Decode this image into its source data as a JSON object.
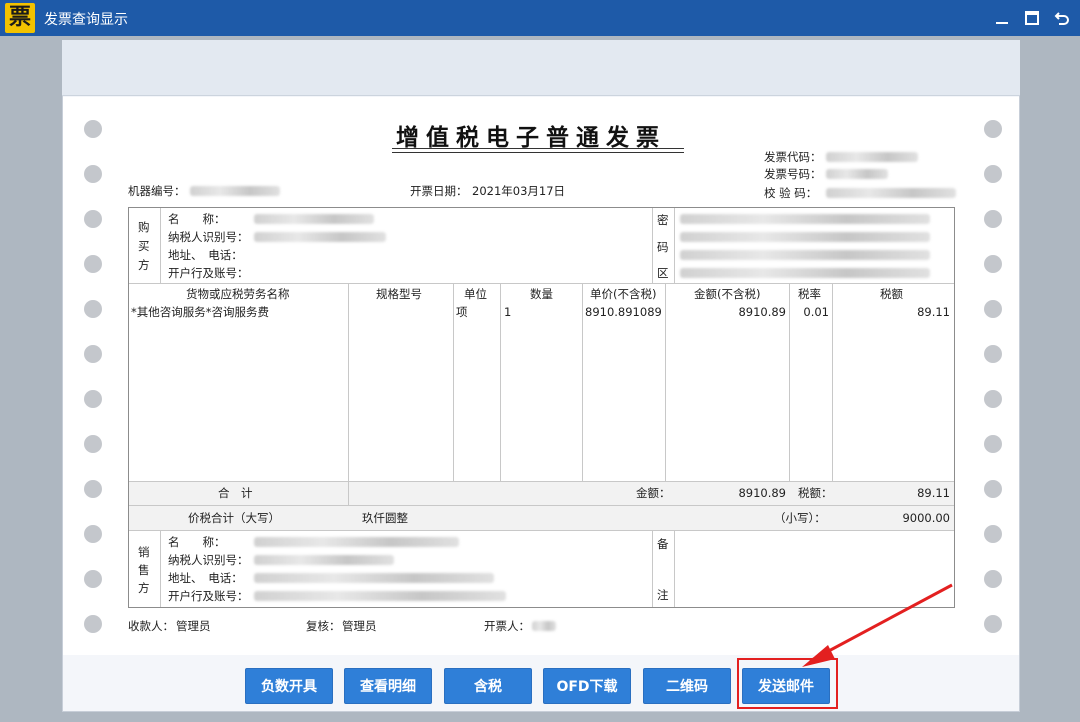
{
  "window": {
    "logo_glyph": "票",
    "title": "发票查询显示",
    "minimize_glyph": "—",
    "restore_glyph": "▭",
    "back_glyph": "↺"
  },
  "invoice": {
    "title": "增值税电子普通发票",
    "invoice_code_label": "发票代码：",
    "invoice_number_label": "发票号码：",
    "check_code_label": "校 验 码：",
    "machine_no_label": "机器编号：",
    "issue_date_label": "开票日期：",
    "issue_date": "2021年03月17日",
    "buyer": {
      "side_label": [
        "购",
        "买",
        "方"
      ],
      "name_label": "名　　称：",
      "tax_id_label": "纳税人识别号：",
      "address_label": "地址、　电话：",
      "bank_label": "开户行及账号："
    },
    "cipher_label": [
      "密",
      "码",
      "区"
    ],
    "columns": {
      "item": "货物或应税劳务名称",
      "spec": "规格型号",
      "unit": "单位",
      "qty": "数量",
      "price": "单价(不含税)",
      "amount": "金额(不含税)",
      "rate": "税率",
      "tax": "税额"
    },
    "row": {
      "item": "*其他咨询服务*咨询服务费",
      "unit": "项",
      "qty": "1",
      "price": "8910.891089",
      "amount": "8910.89",
      "rate": "0.01",
      "tax": "89.11"
    },
    "total_label": "合　计",
    "total_amount_label": "金额：",
    "total_amount": "8910.89",
    "total_tax_label": "税额：",
    "total_tax": "89.11",
    "grand_total_label": "价税合计（大写）",
    "grand_total_words": "玖仟圆整",
    "grand_total_small_label": "（小写）：",
    "grand_total": "9000.00",
    "seller": {
      "side_label": [
        "销",
        "售",
        "方"
      ],
      "name_label": "名　　称：",
      "tax_id_label": "纳税人识别号：",
      "address_label": "地址、　电话：",
      "bank_label": "开户行及账号："
    },
    "remark_label": [
      "备",
      "注"
    ],
    "payee_label": "收款人：",
    "payee": "管理员",
    "reviewer_label": "复核：",
    "reviewer": "管理员",
    "drawer_label": "开票人："
  },
  "actions": [
    {
      "label": "负数开具"
    },
    {
      "label": "查看明细"
    },
    {
      "label": "含税"
    },
    {
      "label": "OFD下载"
    },
    {
      "label": "二维码"
    },
    {
      "label": "发送邮件"
    }
  ],
  "colors": {
    "titlebar": "#1e5aa8",
    "button": "#2f7fd8",
    "highlight": "#e32020"
  }
}
